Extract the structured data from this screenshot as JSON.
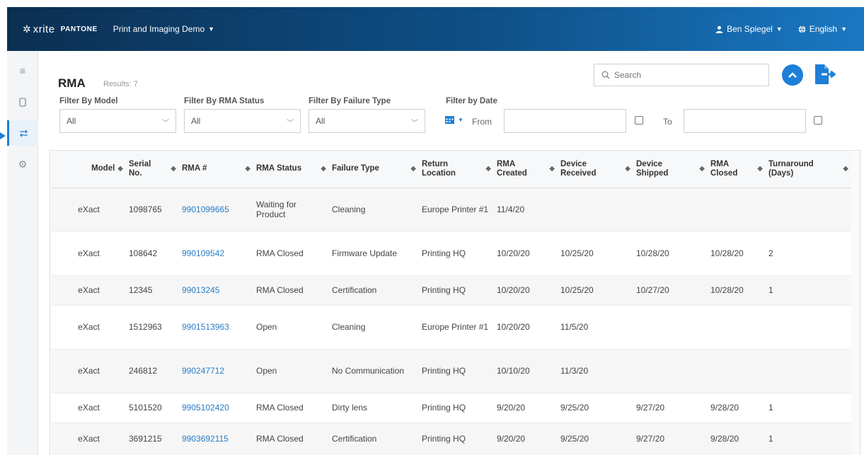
{
  "header": {
    "brand_xrite": "xrite",
    "brand_pantone": "PANTONE",
    "app_title": "Print and Imaging Demo",
    "user_name": "Ben Spiegel",
    "language": "English"
  },
  "page": {
    "title": "RMA",
    "results": "Results: 7"
  },
  "search": {
    "placeholder": "Search"
  },
  "filters": {
    "model_label": "Filter By Model",
    "model_value": "All",
    "status_label": "Filter By RMA Status",
    "status_value": "All",
    "failure_label": "Filter By Failure Type",
    "failure_value": "All",
    "date_label": "Filter by Date",
    "from_label": "From",
    "to_label": "To"
  },
  "table": {
    "columns": [
      [
        "Model"
      ],
      [
        "Serial",
        "No."
      ],
      [
        "RMA #"
      ],
      [
        "RMA Status"
      ],
      [
        "Failure Type"
      ],
      [
        "Return",
        "Location"
      ],
      [
        "RMA",
        "Created"
      ],
      [
        "Device",
        "Received"
      ],
      [
        "Device",
        "Shipped"
      ],
      [
        "RMA",
        "Closed"
      ],
      [
        "Turnaround",
        "(Days)"
      ]
    ],
    "rows": [
      [
        "eXact",
        "1098765",
        "9901099665",
        "Waiting for Product",
        "Cleaning",
        "Europe Printer #1",
        "11/4/20",
        "",
        "",
        "",
        ""
      ],
      [
        "eXact",
        "108642",
        "990109542",
        "RMA Closed",
        "Firmware Update",
        "Printing HQ",
        "10/20/20",
        "10/25/20",
        "10/28/20",
        "10/28/20",
        "2"
      ],
      [
        "eXact",
        "12345",
        "99013245",
        "RMA Closed",
        "Certification",
        "Printing HQ",
        "10/20/20",
        "10/25/20",
        "10/27/20",
        "10/28/20",
        "1"
      ],
      [
        "eXact",
        "1512963",
        "9901513963",
        "Open",
        "Cleaning",
        "Europe Printer #1",
        "10/20/20",
        "11/5/20",
        "",
        "",
        ""
      ],
      [
        "eXact",
        "246812",
        "990247712",
        "Open",
        "No Communication",
        "Printing HQ",
        "10/10/20",
        "11/3/20",
        "",
        "",
        ""
      ],
      [
        "eXact",
        "5101520",
        "9905102420",
        "RMA Closed",
        "Dirty lens",
        "Printing HQ",
        "9/20/20",
        "9/25/20",
        "9/27/20",
        "9/28/20",
        "1"
      ],
      [
        "eXact",
        "3691215",
        "9903692115",
        "RMA Closed",
        "Certification",
        "Printing HQ",
        "9/20/20",
        "9/25/20",
        "9/27/20",
        "9/28/20",
        "1"
      ]
    ]
  },
  "colors": {
    "accent": "#1d7fd6",
    "link": "#2a7dc4",
    "header_dark": "#0b2f52",
    "header_light": "#1a78c2"
  },
  "icons": {
    "logo": "xrite-logo-icon",
    "user": "user-icon",
    "language": "globe-icon",
    "menu": "hamburger-icon",
    "device": "device-icon",
    "rma": "transfer-icon",
    "settings": "gear-icon",
    "search": "search-icon",
    "collapse": "chevron-up-icon",
    "export": "export-icon",
    "calendar": "calendar-icon"
  }
}
